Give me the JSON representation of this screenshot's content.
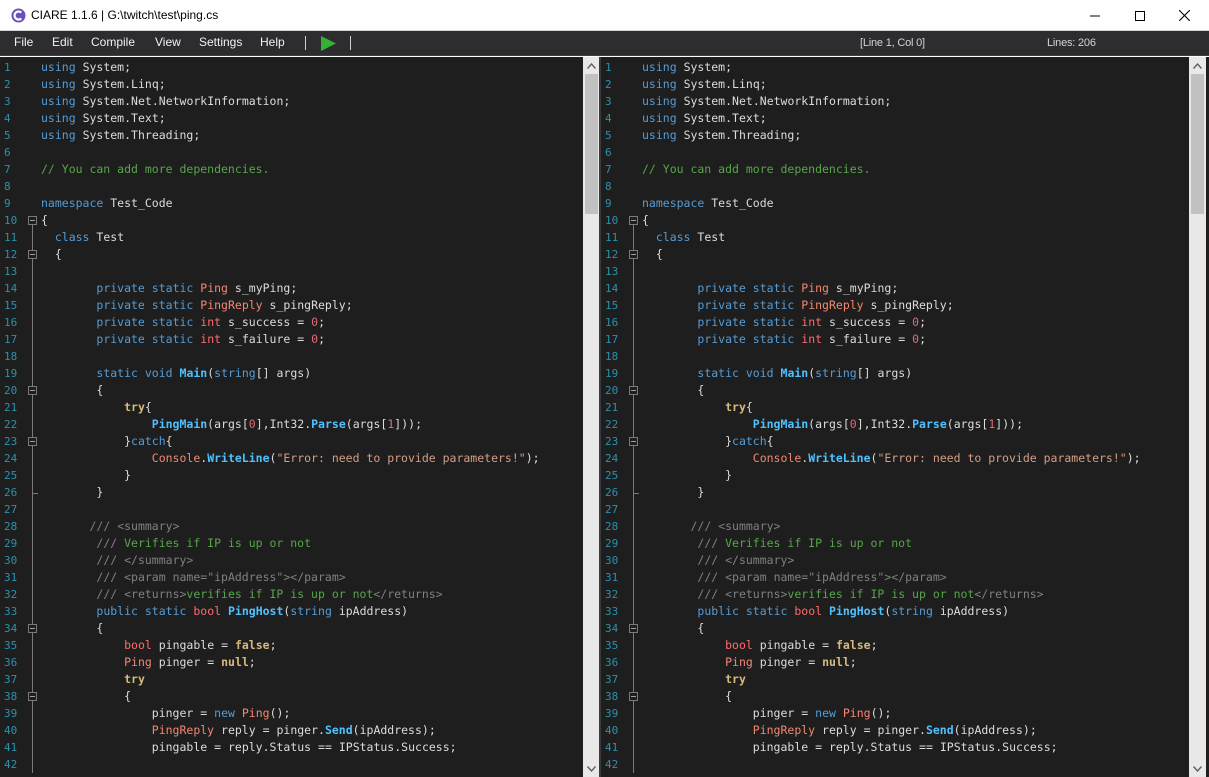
{
  "window": {
    "title": "CIARE 1.1.6 | G:\\twitch\\test\\ping.cs",
    "minimize_icon": "minimize-icon",
    "maximize_icon": "maximize-icon",
    "close_icon": "close-icon"
  },
  "menu": {
    "items": [
      "File",
      "Edit",
      "Compile",
      "View",
      "Settings",
      "Help"
    ],
    "run_icon": "play-icon",
    "run_color": "#34b233"
  },
  "status": {
    "cursor": "[Line 1, Col 0]",
    "lines": "Lines: 206"
  },
  "editor": {
    "line_numbers": [
      "1",
      "2",
      "3",
      "4",
      "5",
      "6",
      "7",
      "8",
      "9",
      "10",
      "11",
      "12",
      "13",
      "14",
      "15",
      "16",
      "17",
      "18",
      "19",
      "20",
      "21",
      "22",
      "23",
      "24",
      "25",
      "26",
      "27",
      "28",
      "29",
      "30",
      "31",
      "32",
      "33",
      "34",
      "35",
      "36",
      "37",
      "38",
      "39",
      "40",
      "41",
      "42"
    ],
    "code_lines": [
      "using System;",
      "using System.Linq;",
      "using System.Net.NetworkInformation;",
      "using System.Text;",
      "using System.Threading;",
      "",
      "// You can add more dependencies.",
      "",
      "namespace Test_Code",
      "{",
      "  class Test",
      "  {",
      "",
      "        private static Ping s_myPing;",
      "        private static PingReply s_pingReply;",
      "        private static int s_success = 0;",
      "        private static int s_failure = 0;",
      "",
      "        static void Main(string[] args)",
      "        {",
      "            try{",
      "                PingMain(args[0],Int32.Parse(args[1]));",
      "            }catch{",
      "                Console.WriteLine(\"Error: need to provide parameters!\");",
      "            }",
      "        }",
      "",
      "       /// <summary>",
      "        /// Verifies if IP is up or not",
      "        /// </summary>",
      "        /// <param name=\"ipAddress\"></param>",
      "        /// <returns>verifies if IP is up or not</returns>",
      "        public static bool PingHost(string ipAddress)",
      "        {",
      "            bool pingable = false;",
      "            Ping pinger = null;",
      "            try",
      "            {",
      "                pinger = new Ping();",
      "                PingReply reply = pinger.Send(ipAddress);",
      "                pingable = reply.Status == IPStatus.Success;",
      ""
    ],
    "scroll_icons": {
      "up": "arrow-up-icon",
      "down": "arrow-down-icon"
    }
  },
  "colors": {
    "editor_bg": "#1e1e1e",
    "menu_bg": "#2d2d30",
    "line_number": "#2b91af",
    "keyword": "#569cd6",
    "comment": "#57a64a",
    "type": "#f48771",
    "method": "#dcdcaa",
    "string": "#d69d85"
  }
}
